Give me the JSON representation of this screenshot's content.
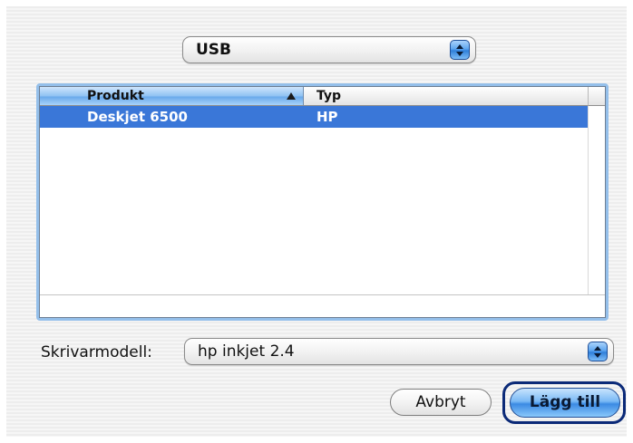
{
  "connection_popup": {
    "value": "USB"
  },
  "printer_table": {
    "columns": [
      "Produkt",
      "Typ"
    ],
    "rows": [
      {
        "produkt": "Deskjet 6500",
        "typ": "HP",
        "selected": true
      }
    ]
  },
  "model_field": {
    "label": "Skrivarmodell:",
    "value": "hp inkjet 2.4"
  },
  "buttons": {
    "cancel_label": "Avbryt",
    "add_label": "Lägg till"
  },
  "colors": {
    "selection": "#3a77d8",
    "focus_ring": "#0b2a78",
    "accent": "#5ea6ef"
  }
}
